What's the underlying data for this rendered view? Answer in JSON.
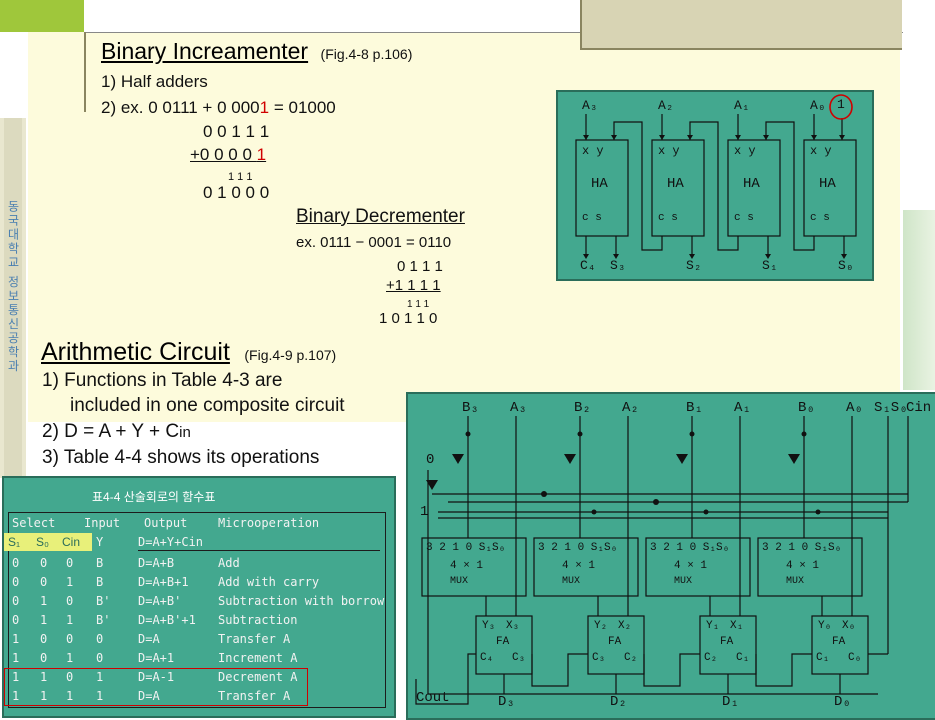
{
  "incrementer": {
    "title": "Binary Increamenter",
    "ref": "(Fig.4-8 p.106)",
    "item1": "1) Half adders",
    "item2_prefix": "2) ex. 0 0111 + 0 000",
    "item2_red": "1",
    "item2_suffix": " = 01000",
    "line_a": "0 0 1 1 1",
    "line_b_prefix": "+0 0 0 0 ",
    "line_b_red": "1",
    "carry": "1  1  1",
    "result": "0 1 0 0 0"
  },
  "decrementer": {
    "title": "Binary Decrementer",
    "example": "ex. 0111 − 0001 = 0110",
    "line_a": "0 1 1 1",
    "line_b": "+1 1 1 1",
    "carry": "1  1  1",
    "result": "1  0 1 1 0"
  },
  "arith": {
    "title": "Arithmetic Circuit",
    "ref": "(Fig.4-9 p.107)",
    "item1a": "1) Functions in Table 4-3 are",
    "item1b": "included in one composite circuit",
    "item2_prefix": "2) D = A + Y + C",
    "item2_sub": "in",
    "item3": "3) Table 4-4 shows its operations"
  },
  "side_label": "동국대학교 정보통신공학과",
  "ha_diagram": {
    "inputs": [
      "A₃",
      "A₂",
      "A₁",
      "A₀"
    ],
    "circled": "1",
    "block": "HA",
    "pins_top": "x   y",
    "pins_bottom": "c   s",
    "outputs": [
      "C₄",
      "S₃",
      "S₂",
      "S₁",
      "S₀"
    ]
  },
  "table": {
    "caption": "표4-4 산술회로의 함수표",
    "headers": [
      "Select",
      "Input",
      "Output",
      "Microoperation"
    ],
    "sub_headers": [
      "S₁",
      "S₀",
      "Cin",
      "Y",
      "D=A+Y+Cin"
    ],
    "rows": [
      [
        "0",
        "0",
        "0",
        "B",
        "D=A+B",
        "Add"
      ],
      [
        "0",
        "0",
        "1",
        "B",
        "D=A+B+1",
        "Add with carry"
      ],
      [
        "0",
        "1",
        "0",
        "B'",
        "D=A+B'",
        "Subtraction with borrow"
      ],
      [
        "0",
        "1",
        "1",
        "B'",
        "D=A+B'+1",
        "Subtraction"
      ],
      [
        "1",
        "0",
        "0",
        "0",
        "D=A",
        "Transfer A"
      ],
      [
        "1",
        "0",
        "1",
        "0",
        "D=A+1",
        "Increment A"
      ],
      [
        "1",
        "1",
        "0",
        "1",
        "D=A-1",
        "Decrement A"
      ],
      [
        "1",
        "1",
        "1",
        "1",
        "D=A",
        "Transfer A"
      ]
    ]
  },
  "arith_diagram": {
    "top_labels": [
      "B₃",
      "A₃",
      "B₂",
      "A₂",
      "B₁",
      "A₁",
      "B₀",
      "A₀",
      "S₁S₀",
      "Cin"
    ],
    "const0": "0",
    "const1": "1",
    "mux_pins": "3 2 1 0 S₁S₀",
    "mux_mid": "4 × 1",
    "mux_name": "MUX",
    "fa_pins": [
      [
        "Y₃",
        "X₃",
        "C₄",
        "C₃"
      ],
      [
        "Y₂",
        "X₂",
        "C₃",
        "C₂"
      ],
      [
        "Y₁",
        "X₁",
        "C₂",
        "C₁"
      ],
      [
        "Y₀",
        "X₀",
        "C₁",
        "C₀"
      ]
    ],
    "fa_name": "FA",
    "cout": "Cout",
    "outputs": [
      "D₃",
      "D₂",
      "D₁",
      "D₀"
    ]
  }
}
